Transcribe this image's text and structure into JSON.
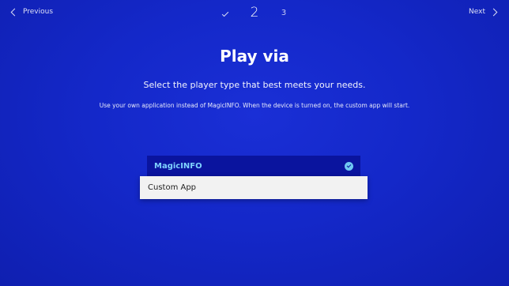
{
  "nav": {
    "previous_label": "Previous",
    "next_label": "Next"
  },
  "steps": {
    "current": "2",
    "next": "3"
  },
  "main": {
    "title": "Play via",
    "subtitle": "Select the player type that best meets your needs.",
    "description": "Use your own application instead of MagicINFO. When the device is turned on, the custom app will start."
  },
  "options": [
    {
      "label": "MagicINFO",
      "selected": true
    },
    {
      "label": "Custom App",
      "focused": true
    }
  ],
  "icons": {
    "previous": "chevron-left-icon",
    "next": "chevron-right-icon",
    "step_done": "check-icon",
    "selected": "check-circle-icon"
  },
  "colors": {
    "background": "#1428c9",
    "selected_option_bg": "#0a149e",
    "selected_option_text": "#7fd3ff",
    "focused_option_bg": "#f2f2f2"
  }
}
